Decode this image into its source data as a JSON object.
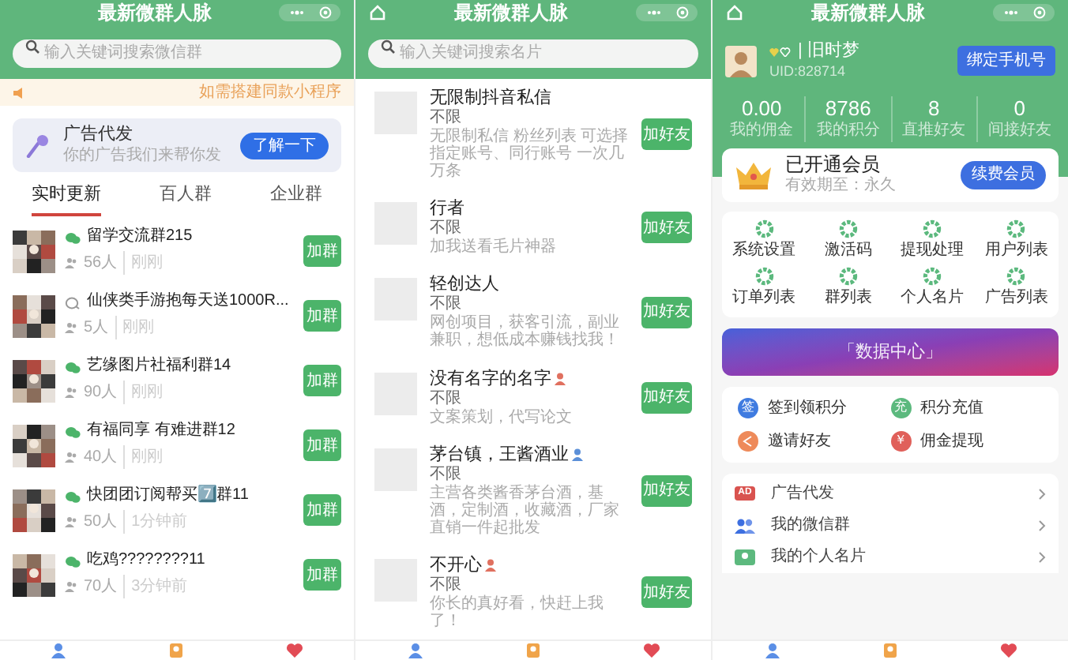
{
  "group_screen": {
    "title": "最新微群人脉",
    "search": {
      "placeholder": "输入关键词搜索微信群"
    },
    "notice": "如需搭建同款小程序",
    "ad_card": {
      "title": "广告代发",
      "subtitle": "你的广告我们来帮你发",
      "button": "了解一下"
    },
    "tabs": [
      {
        "label": "实时更新",
        "selected": true
      },
      {
        "label": "百人群",
        "selected": false
      },
      {
        "label": "企业群",
        "selected": false
      }
    ],
    "groups": [
      {
        "kind": "wechat",
        "name": "留学交流群215",
        "members": "56人",
        "time": "刚刚",
        "button": "加群"
      },
      {
        "kind": "plain",
        "name": "仙侠类手游抱每天送1000R...",
        "members": "5人",
        "time": "刚刚",
        "button": "加群"
      },
      {
        "kind": "wechat",
        "name": "艺缘图片社福利群14",
        "members": "90人",
        "time": "刚刚",
        "button": "加群"
      },
      {
        "kind": "wechat",
        "name": "有福同享 有难进群12",
        "members": "40人",
        "time": "刚刚",
        "button": "加群"
      },
      {
        "kind": "wechat",
        "name": "快团团订阅帮买7️⃣群11",
        "members": "50人",
        "time": "1分钟前",
        "button": "加群"
      },
      {
        "kind": "wechat",
        "name": "吃鸡????????11",
        "members": "70人",
        "time": "3分钟前",
        "button": "加群"
      }
    ]
  },
  "card_screen": {
    "title": "最新微群人脉",
    "search": {
      "placeholder": "输入关键词搜索名片"
    },
    "cards": [
      {
        "name": "无限制抖音私信",
        "tag": "不限",
        "description": "无限制私信 粉丝列表 可选择指定账号、同行账号 一次几万条",
        "button": "加好友"
      },
      {
        "name": "行者",
        "tag": "不限",
        "description": "加我送看毛片神器",
        "button": "加好友"
      },
      {
        "name": "轻创达人",
        "tag": "不限",
        "description": "网创项目，获客引流，副业兼职，想低成本赚钱找我！",
        "button": "加好友"
      },
      {
        "name": "没有名字的名字",
        "color": "#e0705f",
        "tag": "不限",
        "description": "文案策划，代写论文",
        "button": "加好友"
      },
      {
        "name": "茅台镇，王酱酒业",
        "color": "#5b8fd8",
        "tag": "不限",
        "description": "主营各类酱香茅台酒，基酒，定制酒，收藏酒，厂家直销一件起批发",
        "button": "加好友"
      },
      {
        "name": "不开心",
        "color": "#e0705f",
        "tag": "不限",
        "description": "你长的真好看，快赶上我了！",
        "button": "加好友"
      }
    ]
  },
  "profile_screen": {
    "title": "最新微群人脉",
    "user": {
      "name": "| 旧时梦",
      "uid": "UID:828714",
      "button": "绑定手机号"
    },
    "stats": [
      {
        "value": "0.00",
        "label": "我的佣金"
      },
      {
        "value": "8786",
        "label": "我的积分"
      },
      {
        "value": "8",
        "label": "直推好友"
      },
      {
        "value": "0",
        "label": "间接好友"
      }
    ],
    "membership": {
      "title": "已开通会员",
      "expiry": "有效期至：永久",
      "button": "续费会员"
    },
    "tools": [
      "系统设置",
      "激活码",
      "提现处理",
      "用户列表",
      "订单列表",
      "群列表",
      "个人名片",
      "广告列表"
    ],
    "banner": "「数据中心」",
    "actions": [
      {
        "kind": "text",
        "icon_text": "签",
        "label": "签到领积分",
        "color": "#3f7be0"
      },
      {
        "kind": "text",
        "icon_text": "充",
        "label": "积分充值",
        "color": "#5cb97e"
      },
      {
        "kind": "share",
        "label": "邀请好友",
        "color": "#ee8a5a"
      },
      {
        "kind": "text",
        "icon_text": "￥",
        "label": "佣金提现",
        "color": "#e0605a"
      }
    ],
    "menu": [
      {
        "kind": "ad",
        "icon_text": "AD",
        "label": "广告代发"
      },
      {
        "kind": "group",
        "label": "我的微信群"
      },
      {
        "kind": "card",
        "label": "我的个人名片"
      }
    ]
  }
}
